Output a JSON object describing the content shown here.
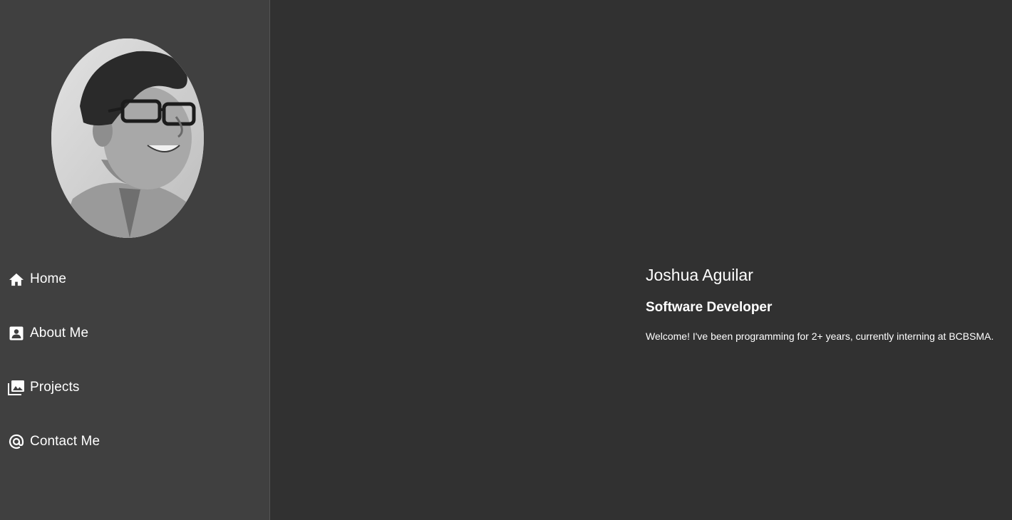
{
  "sidebar": {
    "avatar_alt": "profile photo",
    "nav": [
      {
        "label": "Home",
        "icon": "home-icon"
      },
      {
        "label": "About Me",
        "icon": "contact-card-icon"
      },
      {
        "label": "Projects",
        "icon": "photo-library-icon"
      },
      {
        "label": "Contact Me",
        "icon": "at-sign-icon"
      }
    ]
  },
  "hero": {
    "name": "Joshua Aguilar",
    "role": "Software Developer",
    "welcome": "Welcome! I've been programming for 2+ years, currently interning at BCBSMA."
  },
  "colors": {
    "sidebar_bg": "#404040",
    "main_bg": "#313131",
    "text": "#ffffff"
  }
}
